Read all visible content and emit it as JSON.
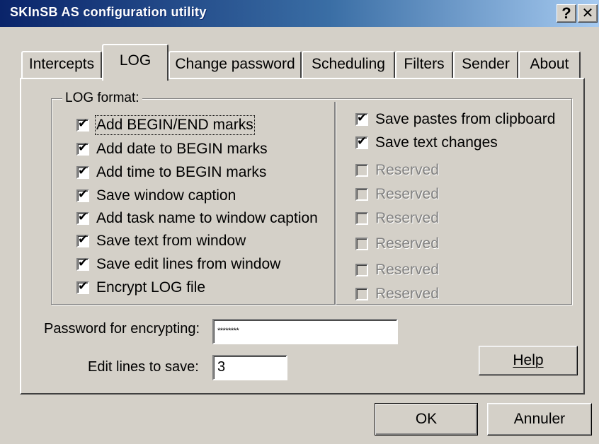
{
  "window": {
    "title": "SKInSB AS configuration utility",
    "help_button": "?",
    "close_button": "✕"
  },
  "tabs": [
    {
      "label": "Intercepts",
      "active": false
    },
    {
      "label": "LOG",
      "active": true
    },
    {
      "label": "Change password",
      "active": false
    },
    {
      "label": "Scheduling",
      "active": false
    },
    {
      "label": "Filters",
      "active": false
    },
    {
      "label": "Sender",
      "active": false
    },
    {
      "label": "About",
      "active": false
    }
  ],
  "log_format": {
    "legend": "LOG format:",
    "left_options": [
      {
        "label": "Add  BEGIN/END marks",
        "checked": true
      },
      {
        "label": "Add date to BEGIN marks",
        "checked": true
      },
      {
        "label": "Add time to BEGIN marks",
        "checked": true
      },
      {
        "label": "Save window caption",
        "checked": true
      },
      {
        "label": "Add task name to window caption",
        "checked": true
      },
      {
        "label": "Save text from window",
        "checked": true
      },
      {
        "label": "Save edit lines from window",
        "checked": true
      },
      {
        "label": "Encrypt LOG file",
        "checked": true
      }
    ],
    "right_options": [
      {
        "label": "Save pastes from clipboard",
        "checked": true,
        "enabled": true
      },
      {
        "label": "Save text changes",
        "checked": true,
        "enabled": true
      },
      {
        "label": "Reserved",
        "checked": false,
        "enabled": false
      },
      {
        "label": "Reserved",
        "checked": false,
        "enabled": false
      },
      {
        "label": "Reserved",
        "checked": false,
        "enabled": false
      },
      {
        "label": "Reserved",
        "checked": false,
        "enabled": false
      },
      {
        "label": "Reserved",
        "checked": false,
        "enabled": false
      },
      {
        "label": "Reserved",
        "checked": false,
        "enabled": false
      }
    ]
  },
  "password": {
    "label": "Password for encrypting:",
    "value": "********"
  },
  "edit_lines": {
    "label": "Edit lines to save:",
    "value": "3"
  },
  "buttons": {
    "help": "Help",
    "ok": "OK",
    "cancel": "Annuler"
  },
  "colors": {
    "face": "#d4d0c8",
    "title_start": "#0a246a",
    "title_end": "#a6caf0",
    "disabled_text": "#808080"
  }
}
